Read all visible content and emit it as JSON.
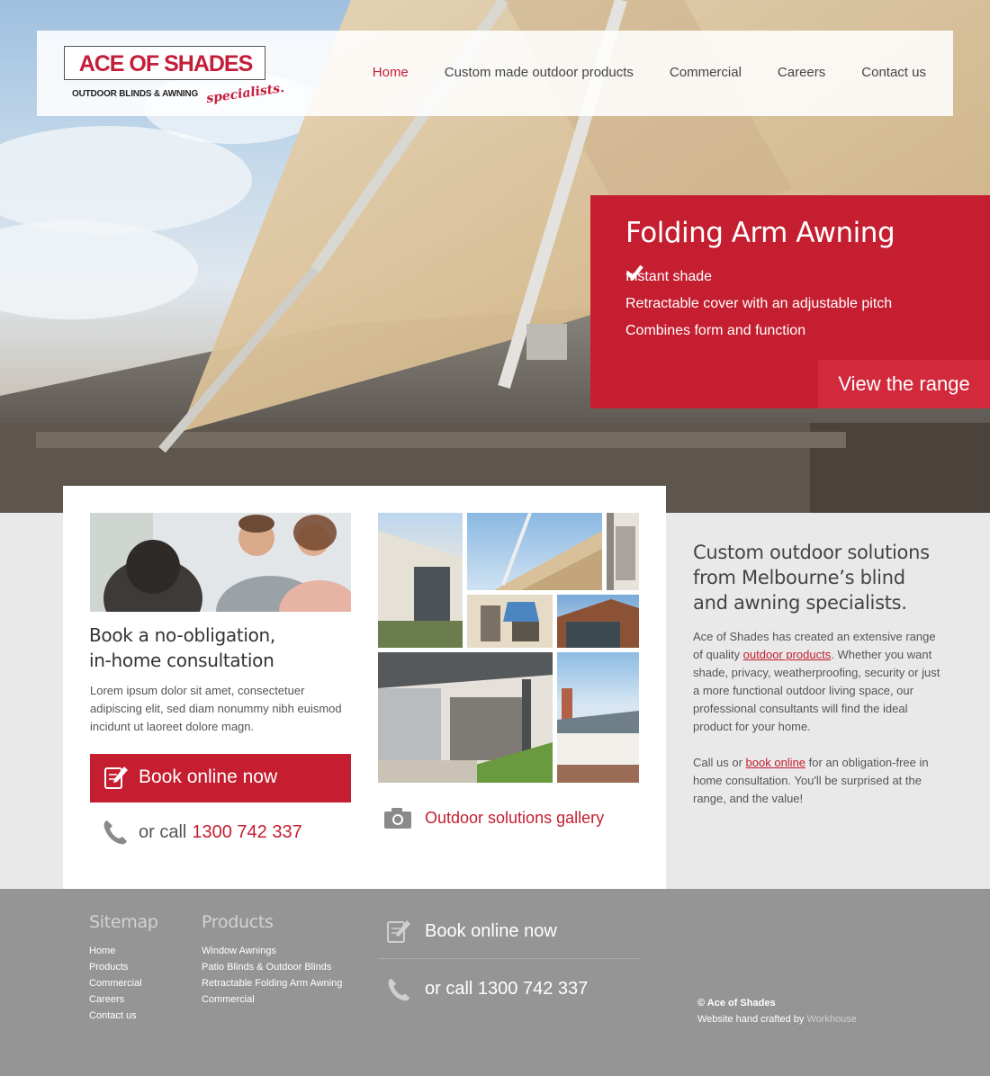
{
  "brand": {
    "name": "ACE OF SHADES",
    "tagline": "OUTDOOR BLINDS & AWNING",
    "script": "specialists.",
    "red": "#c41e30"
  },
  "nav": {
    "items": [
      {
        "label": "Home",
        "active": true
      },
      {
        "label": "Custom made outdoor products"
      },
      {
        "label": "Commercial"
      },
      {
        "label": "Careers"
      },
      {
        "label": "Contact us"
      }
    ]
  },
  "promo": {
    "title": "Folding Arm Awning",
    "features": [
      "Instant shade",
      "Retractable cover with an adjustable pitch",
      "Combines form and function"
    ],
    "button": "View the range"
  },
  "consult": {
    "title_line1": "Book a no-obligation,",
    "title_line2": "in-home consultation",
    "text": "Lorem ipsum dolor sit amet, consectetuer adipiscing elit, sed diam nonummy nibh euismod incidunt ut laoreet dolore magn.",
    "book_button": "Book online now",
    "call_prefix": "or call",
    "phone": "1300 742 337"
  },
  "gallery": {
    "link": "Outdoor solutions gallery"
  },
  "side": {
    "heading": "Custom outdoor solutions from Melbourne’s blind and awning specialists.",
    "p1_before": "Ace of Shades has created an extensive range of quality ",
    "p1_link": "outdoor products",
    "p1_after": ". Whether you want shade, privacy, weatherproofing, security or just a more functional outdoor living space, our professional consultants will find the ideal product for your home.",
    "p2_before": "Call us or ",
    "p2_link": "book online",
    "p2_after": " for an obligation-free in home consultation. You'll be surprised at the range, and the value!"
  },
  "footer": {
    "sitemap": {
      "title": "Sitemap",
      "items": [
        "Home",
        "Products",
        "Commercial",
        "Careers",
        "Contact us"
      ]
    },
    "products": {
      "title": "Products",
      "items": [
        "Window Awnings",
        "Patio Blinds & Outdoor Blinds",
        "Retractable Folding Arm Awning",
        "Commercial"
      ]
    },
    "book_button": "Book online now",
    "call_text": "or call 1300 742 337",
    "copyright": "© Ace of Shades",
    "credit_prefix": "Website hand crafted by ",
    "credit_link": "Workhouse"
  }
}
